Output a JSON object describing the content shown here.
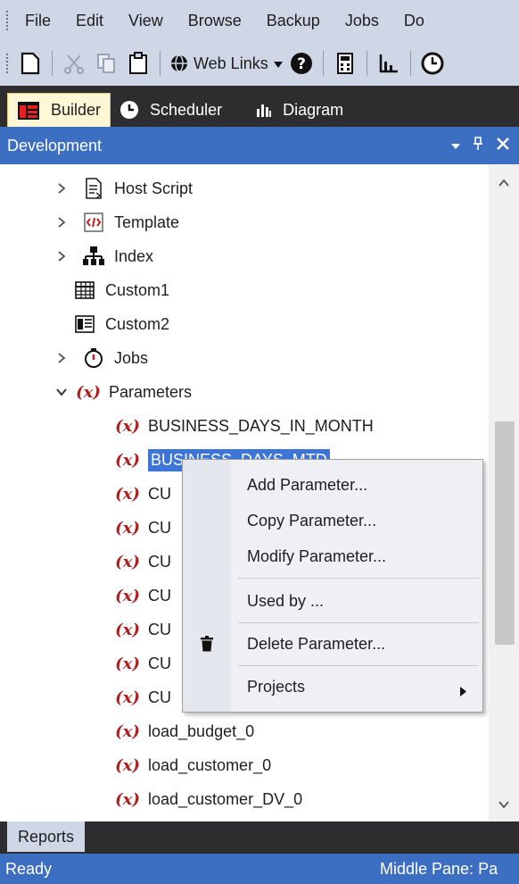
{
  "menubar": {
    "items": [
      "File",
      "Edit",
      "View",
      "Browse",
      "Backup",
      "Jobs",
      "Do"
    ]
  },
  "toolbar": {
    "new_icon": "new-document-icon",
    "cut_icon": "cut-icon",
    "copy_icon": "copy-icon",
    "paste_icon": "paste-icon",
    "web_links_label": "Web Links",
    "help_icon": "help-icon",
    "calculator_icon": "calculator-icon",
    "chart_icon": "chart-icon",
    "clock_icon": "clock-icon"
  },
  "tabs": [
    {
      "label": "Builder",
      "icon": "builder-icon",
      "active": true
    },
    {
      "label": "Scheduler",
      "icon": "clock-icon",
      "active": false
    },
    {
      "label": "Diagram",
      "icon": "bar-chart-icon",
      "active": false
    }
  ],
  "pane": {
    "title": "Development"
  },
  "tree": {
    "items": [
      {
        "label": "Host Script",
        "icon": "host-script-icon",
        "expander": "collapsed"
      },
      {
        "label": "Template",
        "icon": "template-icon",
        "expander": "collapsed"
      },
      {
        "label": "Index",
        "icon": "index-icon",
        "expander": "collapsed"
      },
      {
        "label": "Custom1",
        "icon": "grid-icon",
        "expander": "none"
      },
      {
        "label": "Custom2",
        "icon": "form-icon",
        "expander": "none"
      },
      {
        "label": "Jobs",
        "icon": "stopwatch-icon",
        "expander": "collapsed"
      },
      {
        "label": "Parameters",
        "icon": "parameter-icon",
        "expander": "expanded"
      }
    ],
    "param_symbol": "(x)",
    "parameters": [
      "BUSINESS_DAYS_IN_MONTH",
      "BUSINESS_DAYS_MTD",
      "CU",
      "CU",
      "CU",
      "CU",
      "CU",
      "CU",
      "CU",
      "load_budget_0",
      "load_customer_0",
      "load_customer_DV_0"
    ]
  },
  "context_menu": {
    "items": [
      {
        "label": "Add Parameter...",
        "icon": ""
      },
      {
        "label": "Copy Parameter...",
        "icon": ""
      },
      {
        "label": "Modify Parameter...",
        "icon": ""
      },
      {
        "label": "Used by ...",
        "icon": ""
      },
      {
        "label": "Delete Parameter...",
        "icon": "trash-icon"
      },
      {
        "label": "Projects",
        "icon": "",
        "submenu": true
      }
    ]
  },
  "bottom_tabs": [
    "Reports"
  ],
  "status": {
    "left": "Ready",
    "right": "Middle Pane: Pa"
  },
  "colors": {
    "chrome": "#cfd6e5",
    "header_blue": "#3c6fc1",
    "selection": "#3c74d8",
    "param_red": "#b11c1c",
    "dark": "#2d2d30"
  }
}
